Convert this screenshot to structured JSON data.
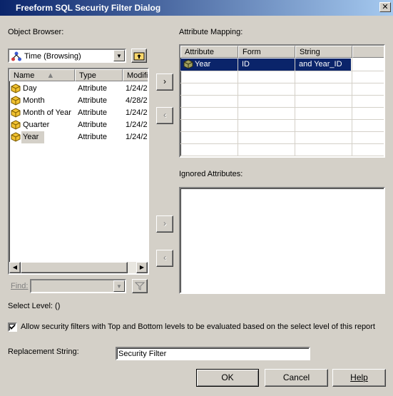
{
  "window": {
    "title": "Freeform SQL Security Filter Dialog",
    "close_glyph": "✕"
  },
  "object_browser": {
    "label": "Object Browser:",
    "combo_value": "Time (Browsing)",
    "columns": [
      "Name",
      "Type",
      "Modific"
    ],
    "rows": [
      {
        "name": "Day",
        "type": "Attribute",
        "modified": "1/24/2"
      },
      {
        "name": "Month",
        "type": "Attribute",
        "modified": "4/28/2"
      },
      {
        "name": "Month of Year",
        "type": "Attribute",
        "modified": "1/24/2"
      },
      {
        "name": "Quarter",
        "type": "Attribute",
        "modified": "1/24/2"
      },
      {
        "name": "Year",
        "type": "Attribute",
        "modified": "1/24/2"
      }
    ],
    "find_label": "Find:",
    "find_value": ""
  },
  "attribute_mapping": {
    "label": "Attribute Mapping:",
    "columns": [
      "Attribute",
      "Form",
      "String"
    ],
    "rows": [
      {
        "attribute": "Year",
        "form": "ID",
        "string": "and Year_ID"
      }
    ]
  },
  "ignored": {
    "label": "Ignored Attributes:"
  },
  "arrows": {
    "right": "›",
    "left": "‹"
  },
  "select_level": "Select Level: ()",
  "allow_checkbox": {
    "checked": true,
    "label": "Allow security filters with Top and Bottom levels to be evaluated based on the select level of this report"
  },
  "replacement": {
    "label": "Replacement String:",
    "value": "Security Filter"
  },
  "buttons": {
    "ok": "OK",
    "cancel": "Cancel",
    "help": "Help"
  }
}
